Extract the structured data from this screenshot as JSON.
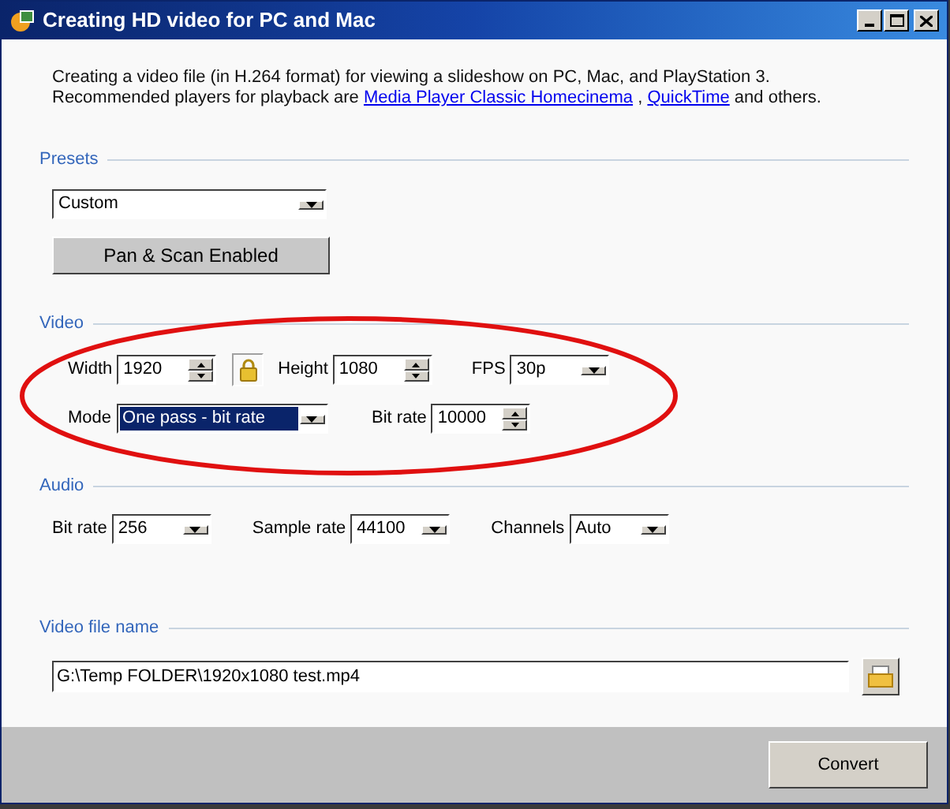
{
  "window": {
    "title": "Creating HD video for PC and Mac"
  },
  "description": {
    "text": "Creating a video file (in H.264 format) for viewing a slideshow on PC, Mac, and PlayStation 3. Recommended players for playback are ",
    "links": [
      "Media Player Classic Homecinema",
      "QuickTime"
    ],
    "separator": " , ",
    "tail": " and others."
  },
  "presets": {
    "heading": "Presets",
    "dropdown": {
      "value": "Custom"
    },
    "button": "Pan & Scan Enabled"
  },
  "video": {
    "heading": "Video",
    "rows": [
      [
        {
          "kind": "spinner",
          "label": "Width",
          "value": "1920",
          "focused": false
        },
        {
          "kind": "lock"
        },
        {
          "kind": "spinner",
          "label": "Height",
          "value": "1080",
          "focused": false
        },
        {
          "kind": "dropdown",
          "label": "FPS",
          "value": "30p",
          "focused": false
        }
      ],
      [
        {
          "kind": "dropdown",
          "label": "Mode",
          "value": "One pass - bit rate",
          "focused": true
        },
        {
          "kind": "spinner",
          "label": "Bit rate",
          "value": "10000",
          "focused": false
        }
      ]
    ]
  },
  "audio": {
    "heading": "Audio",
    "controls": [
      {
        "kind": "dropdown",
        "label": "Bit rate",
        "value": "256",
        "focused": false
      },
      {
        "kind": "dropdown",
        "label": "Sample rate",
        "value": "44100",
        "focused": false
      },
      {
        "kind": "dropdown",
        "label": "Channels",
        "value": "Auto",
        "focused": false
      }
    ]
  },
  "file": {
    "heading": "Video file name",
    "value": "G:\\Temp FOLDER\\1920x1080 test.mp4"
  },
  "footer": {
    "button": "Convert"
  }
}
